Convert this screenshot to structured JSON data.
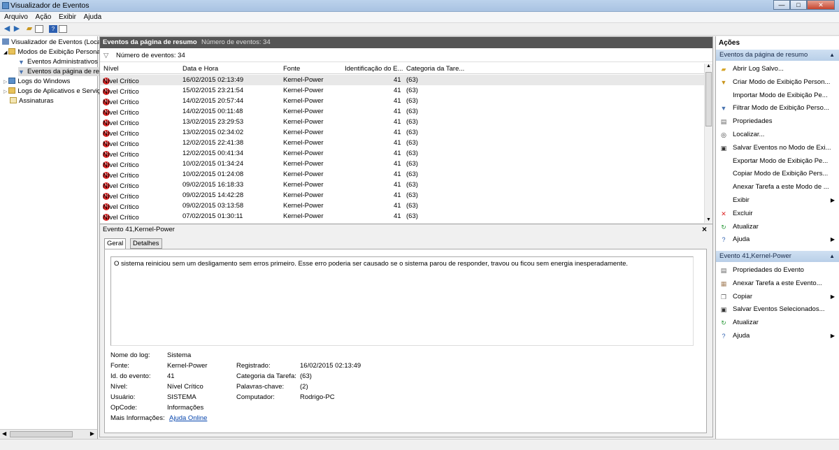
{
  "window": {
    "title": "Visualizador de Eventos",
    "buttons": {
      "min": "—",
      "max": "□",
      "close": "✕"
    }
  },
  "menu": [
    "Arquivo",
    "Ação",
    "Exibir",
    "Ajuda"
  ],
  "tree": [
    {
      "label": "Visualizador de Eventos (Local)",
      "icon": "event-viewer-icon"
    },
    {
      "label": "Modos de Exibição Personalizados",
      "icon": "folder-icon"
    },
    {
      "label": "Eventos Administrativos",
      "icon": "filter-icon"
    },
    {
      "label": "Eventos da página de resumo",
      "icon": "filter-icon"
    },
    {
      "label": "Logs do Windows",
      "icon": "folder-icon"
    },
    {
      "label": "Logs de Aplicativos e Serviços",
      "icon": "folder-icon"
    },
    {
      "label": "Assinaturas",
      "icon": "subscription-icon"
    }
  ],
  "main": {
    "header_title": "Eventos da página de resumo",
    "header_count": "Número de eventos: 34",
    "filter_text": "Número de eventos: 34",
    "columns": [
      "Nível",
      "Data e Hora",
      "Fonte",
      "Identificação do E...",
      "Categoria da Tare..."
    ],
    "rows": [
      {
        "level": "Nível Crítico",
        "datetime": "16/02/2015 02:13:49",
        "source": "Kernel-Power",
        "id": "41",
        "category": "(63)"
      },
      {
        "level": "Nível Crítico",
        "datetime": "15/02/2015 23:21:54",
        "source": "Kernel-Power",
        "id": "41",
        "category": "(63)"
      },
      {
        "level": "Nível Crítico",
        "datetime": "14/02/2015 20:57:44",
        "source": "Kernel-Power",
        "id": "41",
        "category": "(63)"
      },
      {
        "level": "Nível Crítico",
        "datetime": "14/02/2015 00:11:48",
        "source": "Kernel-Power",
        "id": "41",
        "category": "(63)"
      },
      {
        "level": "Nível Crítico",
        "datetime": "13/02/2015 23:29:53",
        "source": "Kernel-Power",
        "id": "41",
        "category": "(63)"
      },
      {
        "level": "Nível Crítico",
        "datetime": "13/02/2015 02:34:02",
        "source": "Kernel-Power",
        "id": "41",
        "category": "(63)"
      },
      {
        "level": "Nível Crítico",
        "datetime": "12/02/2015 22:41:38",
        "source": "Kernel-Power",
        "id": "41",
        "category": "(63)"
      },
      {
        "level": "Nível Crítico",
        "datetime": "12/02/2015 00:41:34",
        "source": "Kernel-Power",
        "id": "41",
        "category": "(63)"
      },
      {
        "level": "Nível Crítico",
        "datetime": "10/02/2015 01:34:24",
        "source": "Kernel-Power",
        "id": "41",
        "category": "(63)"
      },
      {
        "level": "Nível Crítico",
        "datetime": "10/02/2015 01:24:08",
        "source": "Kernel-Power",
        "id": "41",
        "category": "(63)"
      },
      {
        "level": "Nível Crítico",
        "datetime": "09/02/2015 16:18:33",
        "source": "Kernel-Power",
        "id": "41",
        "category": "(63)"
      },
      {
        "level": "Nível Crítico",
        "datetime": "09/02/2015 14:42:28",
        "source": "Kernel-Power",
        "id": "41",
        "category": "(63)"
      },
      {
        "level": "Nível Crítico",
        "datetime": "09/02/2015 03:13:58",
        "source": "Kernel-Power",
        "id": "41",
        "category": "(63)"
      },
      {
        "level": "Nível Crítico",
        "datetime": "07/02/2015 01:30:11",
        "source": "Kernel-Power",
        "id": "41",
        "category": "(63)"
      }
    ]
  },
  "detail": {
    "title": "Evento 41,Kernel-Power",
    "close": "×",
    "tabs": [
      "Geral",
      "Detalhes"
    ],
    "description": "O sistema reiniciou sem um desligamento sem erros primeiro. Esse erro poderia ser causado se o sistema parou de responder, travou ou ficou sem energia inesperadamente.",
    "fields": {
      "log_name_label": "Nome do log:",
      "log_name": "Sistema",
      "source_label": "Fonte:",
      "source": "Kernel-Power",
      "logged_label": "Registrado:",
      "logged": "16/02/2015 02:13:49",
      "event_id_label": "Id. do evento:",
      "event_id": "41",
      "task_cat_label": "Categoria da Tarefa:",
      "task_cat": "(63)",
      "level_label": "Nível:",
      "level": "Nível Crítico",
      "keywords_label": "Palavras-chave:",
      "keywords": "(2)",
      "user_label": "Usuário:",
      "user": "SISTEMA",
      "computer_label": "Computador:",
      "computer": "Rodrigo-PC",
      "opcode_label": "OpCode:",
      "opcode": "Informações",
      "more_info_label": "Mais Informações:",
      "more_info": "Ajuda Online"
    }
  },
  "actions": {
    "title": "Ações",
    "section1": "Eventos da página de resumo",
    "items1": [
      {
        "label": "Abrir Log Salvo...",
        "icon": "open-log-icon",
        "arrow": false
      },
      {
        "label": "Criar Modo de Exibição Person...",
        "icon": "create-view-icon",
        "arrow": false
      },
      {
        "label": "Importar Modo de Exibição Pe...",
        "icon": "",
        "arrow": false
      },
      {
        "label": "Filtrar Modo de Exibição Perso...",
        "icon": "filter-icon",
        "arrow": false
      },
      {
        "label": "Propriedades",
        "icon": "properties-icon",
        "arrow": false
      },
      {
        "label": "Localizar...",
        "icon": "find-icon",
        "arrow": false
      },
      {
        "label": "Salvar Eventos no Modo de Exi...",
        "icon": "save-icon",
        "arrow": false
      },
      {
        "label": "Exportar Modo de Exibição Pe...",
        "icon": "",
        "arrow": false
      },
      {
        "label": "Copiar Modo de Exibição Pers...",
        "icon": "",
        "arrow": false
      },
      {
        "label": "Anexar Tarefa a este Modo de ...",
        "icon": "",
        "arrow": false
      },
      {
        "label": "Exibir",
        "icon": "",
        "arrow": true
      },
      {
        "label": "Excluir",
        "icon": "delete-icon",
        "arrow": false
      },
      {
        "label": "Atualizar",
        "icon": "refresh-icon",
        "arrow": false
      },
      {
        "label": "Ajuda",
        "icon": "help-icon",
        "arrow": true
      }
    ],
    "section2": "Evento 41,Kernel-Power",
    "items2": [
      {
        "label": "Propriedades do Evento",
        "icon": "properties-icon",
        "arrow": false
      },
      {
        "label": "Anexar Tarefa a este Evento...",
        "icon": "task-icon",
        "arrow": false
      },
      {
        "label": "Copiar",
        "icon": "copy-icon",
        "arrow": true
      },
      {
        "label": "Salvar Eventos Selecionados...",
        "icon": "save-icon",
        "arrow": false
      },
      {
        "label": "Atualizar",
        "icon": "refresh-icon",
        "arrow": false
      },
      {
        "label": "Ajuda",
        "icon": "help-icon",
        "arrow": true
      }
    ]
  }
}
